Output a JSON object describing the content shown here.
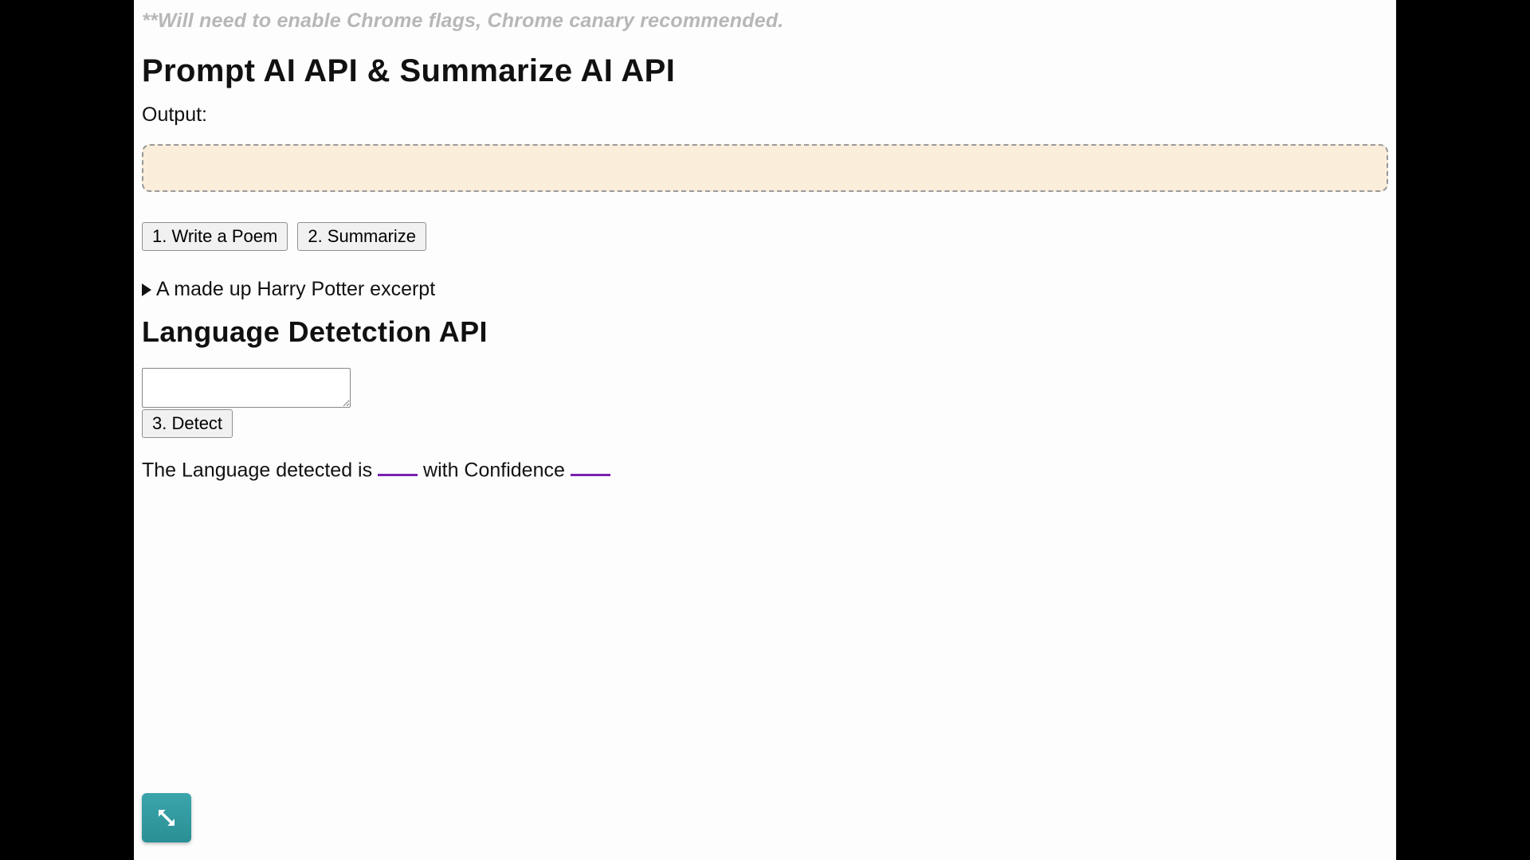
{
  "note": "**Will need to enable Chrome flags, Chrome canary recommended.",
  "section1": {
    "title": "Prompt AI API & Summarize AI API",
    "output_label": "Output:",
    "output_value": "",
    "buttons": {
      "write_poem": "1. Write a Poem",
      "summarize": "2. Summarize"
    },
    "disclosure_label": "A made up Harry Potter excerpt"
  },
  "section2": {
    "title": "Language Detetction API",
    "textarea_value": "",
    "detect_button": "3. Detect",
    "result_prefix": "The Language detected is ",
    "result_mid": " with Confidence ",
    "detected_language": "",
    "confidence": ""
  },
  "corner_icon_name": "expand-diagonal-icon"
}
